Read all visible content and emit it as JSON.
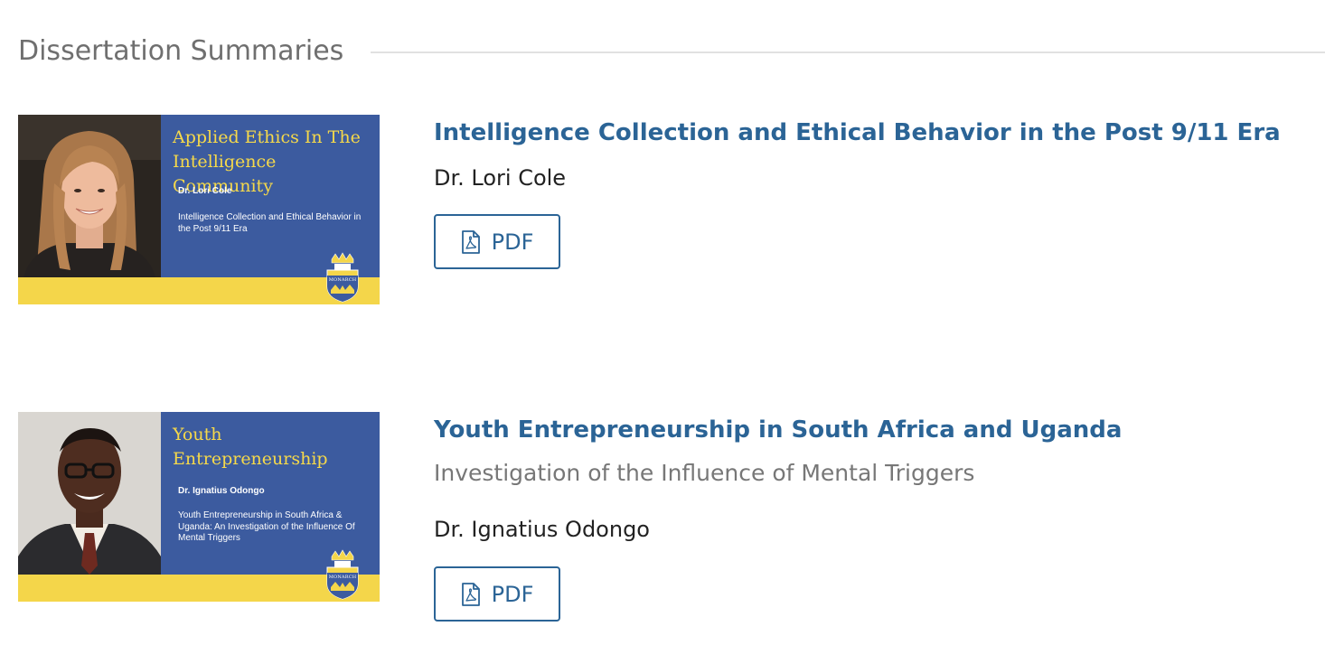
{
  "section": {
    "title": "Dissertation Summaries"
  },
  "entries": [
    {
      "title": "Intelligence Collection and Ethical Behavior in the Post 9/11 Era",
      "author": "Dr. Lori Cole",
      "button_label": "PDF",
      "thumbnail": {
        "heading": "Applied Ethics In The Intelligence Community",
        "author": "Dr. Lori Cole",
        "description": "Intelligence Collection and Ethical Behavior in the Post 9/11 Era",
        "crest_label": "MONARCH"
      }
    },
    {
      "title": "Youth Entrepreneurship in South Africa and Uganda",
      "subtitle": "Investigation of the Influence of Mental Triggers",
      "author": "Dr. Ignatius Odongo",
      "button_label": "PDF",
      "thumbnail": {
        "heading": "Youth Entrepreneurship",
        "author": "Dr. Ignatius Odongo",
        "description": "Youth Entrepreneurship in South Africa & Uganda: An Investigation of the Influence Of Mental Triggers",
        "crest_label": "MONARCH"
      }
    }
  ],
  "colors": {
    "title_link": "#2b6496",
    "thumbnail_panel": "#3c5b9f",
    "thumbnail_band": "#f4d64a",
    "thumbnail_heading": "#f6d94a"
  },
  "icons": {
    "pdf": "pdf-file-icon"
  }
}
